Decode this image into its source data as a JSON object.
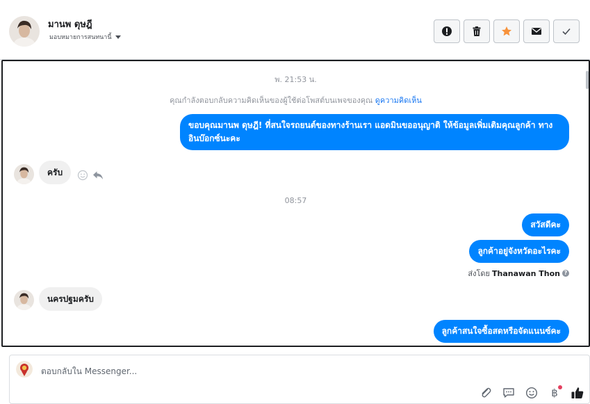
{
  "header": {
    "name": "มานพ ดุษฎี",
    "assign_label": "มอบหมายการสนทนานี้",
    "actions": [
      {
        "name": "report-icon"
      },
      {
        "name": "trash-icon"
      },
      {
        "name": "star-icon"
      },
      {
        "name": "envelope-icon"
      },
      {
        "name": "check-icon"
      }
    ]
  },
  "thread": {
    "timestamp_1": "พ. 21:53 น.",
    "notice_text": "คุณกำลังตอบกลับความคิดเห็นของผู้ใช้ต่อโพสต์บนเพจของคุณ",
    "notice_link": "ดูความคิดเห็น",
    "msg_out_1": "ขอบคุณมานพ ดุษฎี! ที่สนใจรถยนต์ของทางร้านเรา แอดมินขออนุญาติ ให้ข้อมูลเพิ่มเติมคุณลูกค้า ทางอินบ๊อกซ์นะคะ",
    "msg_in_1": "ครับ",
    "timestamp_2": "08:57",
    "msg_out_2": "สวัสดีคะ",
    "msg_out_3": "ลูกค้าอยู่จังหวัดอะไรคะ",
    "sent_by_label": "ส่งโดย",
    "sent_by_name": "Thanawan Thon",
    "msg_in_2": "นครปฐมครับ",
    "msg_out_4": "ลูกค้าสนใจซื้อสดหรือจัดแนนซ์คะ"
  },
  "composer": {
    "placeholder": "ตอบกลับใน Messenger...",
    "tools": [
      "paperclip-icon",
      "speech-bubble-icon",
      "smiley-icon",
      "baht-icon",
      "thumbs-up-icon"
    ],
    "brand_color": "#0084ff"
  }
}
